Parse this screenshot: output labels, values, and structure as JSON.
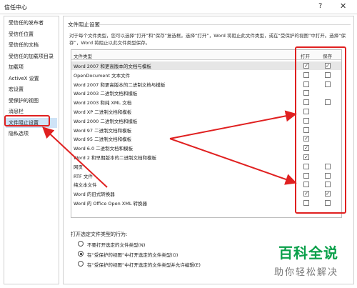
{
  "window": {
    "title": "信任中心",
    "help_glyph": "?",
    "close_glyph": "✕"
  },
  "sidebar": {
    "items": [
      {
        "label": "受信任的发布者",
        "selected": false
      },
      {
        "label": "受信任位置",
        "selected": false
      },
      {
        "label": "受信任的文档",
        "selected": false
      },
      {
        "label": "受信任的加载项目录",
        "selected": false
      },
      {
        "label": "加载项",
        "selected": false
      },
      {
        "label": "ActiveX 设置",
        "selected": false
      },
      {
        "label": "宏设置",
        "selected": false
      },
      {
        "label": "受保护的视图",
        "selected": false
      },
      {
        "label": "消息栏",
        "selected": false
      },
      {
        "label": "文件阻止设置",
        "selected": true
      },
      {
        "label": "隐私选项",
        "selected": false
      }
    ]
  },
  "main": {
    "section_title": "文件阻止设置",
    "description": "对于每个文件类型，您可以选择“打开”和“保存”复选框。选择“打开”，Word 将阻止此文件类型，或在“受保护的视图”中打开。选择“保存”，Word 将阻止以此文件类型保存。",
    "table": {
      "col_type": "文件类型",
      "col_open": "打开",
      "col_save": "保存",
      "rows": [
        {
          "name": "Word 2007 和更高版本的文档与模板",
          "open": "checked",
          "save": "checked",
          "selected": true
        },
        {
          "name": "OpenDocument 文本文件",
          "open": "unchecked",
          "save": "unchecked"
        },
        {
          "name": "Word 2007 和更高版本的二进制文档与模板",
          "open": "unchecked",
          "save": "unchecked"
        },
        {
          "name": "Word 2003 二进制文档和模板",
          "open": "unchecked",
          "save": "none"
        },
        {
          "name": "Word 2003 和纯 XML 文档",
          "open": "unchecked",
          "save": "unchecked"
        },
        {
          "name": "Word XP 二进制文档和模板",
          "open": "unchecked",
          "save": "none"
        },
        {
          "name": "Word 2000 二进制文档和模板",
          "open": "unchecked",
          "save": "none"
        },
        {
          "name": "Word 97 二进制文档和模板",
          "open": "unchecked",
          "save": "none"
        },
        {
          "name": "Word 95 二进制文档和模板",
          "open": "checked",
          "save": "none"
        },
        {
          "name": "Word 6.0 二进制文档和模板",
          "open": "checked",
          "save": "none"
        },
        {
          "name": "Word 2 和早期版本的二进制文档和模板",
          "open": "checked",
          "save": "none"
        },
        {
          "name": "网页",
          "open": "unchecked",
          "save": "unchecked"
        },
        {
          "name": "RTF 文件",
          "open": "unchecked",
          "save": "unchecked"
        },
        {
          "name": "纯文本文件",
          "open": "unchecked",
          "save": "unchecked"
        },
        {
          "name": "Word 的旧式转换器",
          "open": "checked",
          "save": "checked"
        },
        {
          "name": "Word 的 Office Open XML 转换器",
          "open": "unchecked",
          "save": "unchecked"
        }
      ]
    },
    "behavior": {
      "label": "打开选定文件类型的行为:",
      "options": [
        {
          "label": "不要打开选定的文件类型(N)",
          "selected": false
        },
        {
          "label": "在“受保护的视图”中打开选定的文件类型(O)",
          "selected": true
        },
        {
          "label": "在“受保护的视图”中打开选定的文件类型并允许编辑(E)",
          "selected": false
        }
      ]
    }
  },
  "check_glyph": "✓",
  "watermark": {
    "title": "百科全说",
    "subtitle": "助你轻松解决"
  },
  "colors": {
    "annotation": "#e02020",
    "selection": "#cfe3f7",
    "watermark_green": "#0aa04a"
  }
}
